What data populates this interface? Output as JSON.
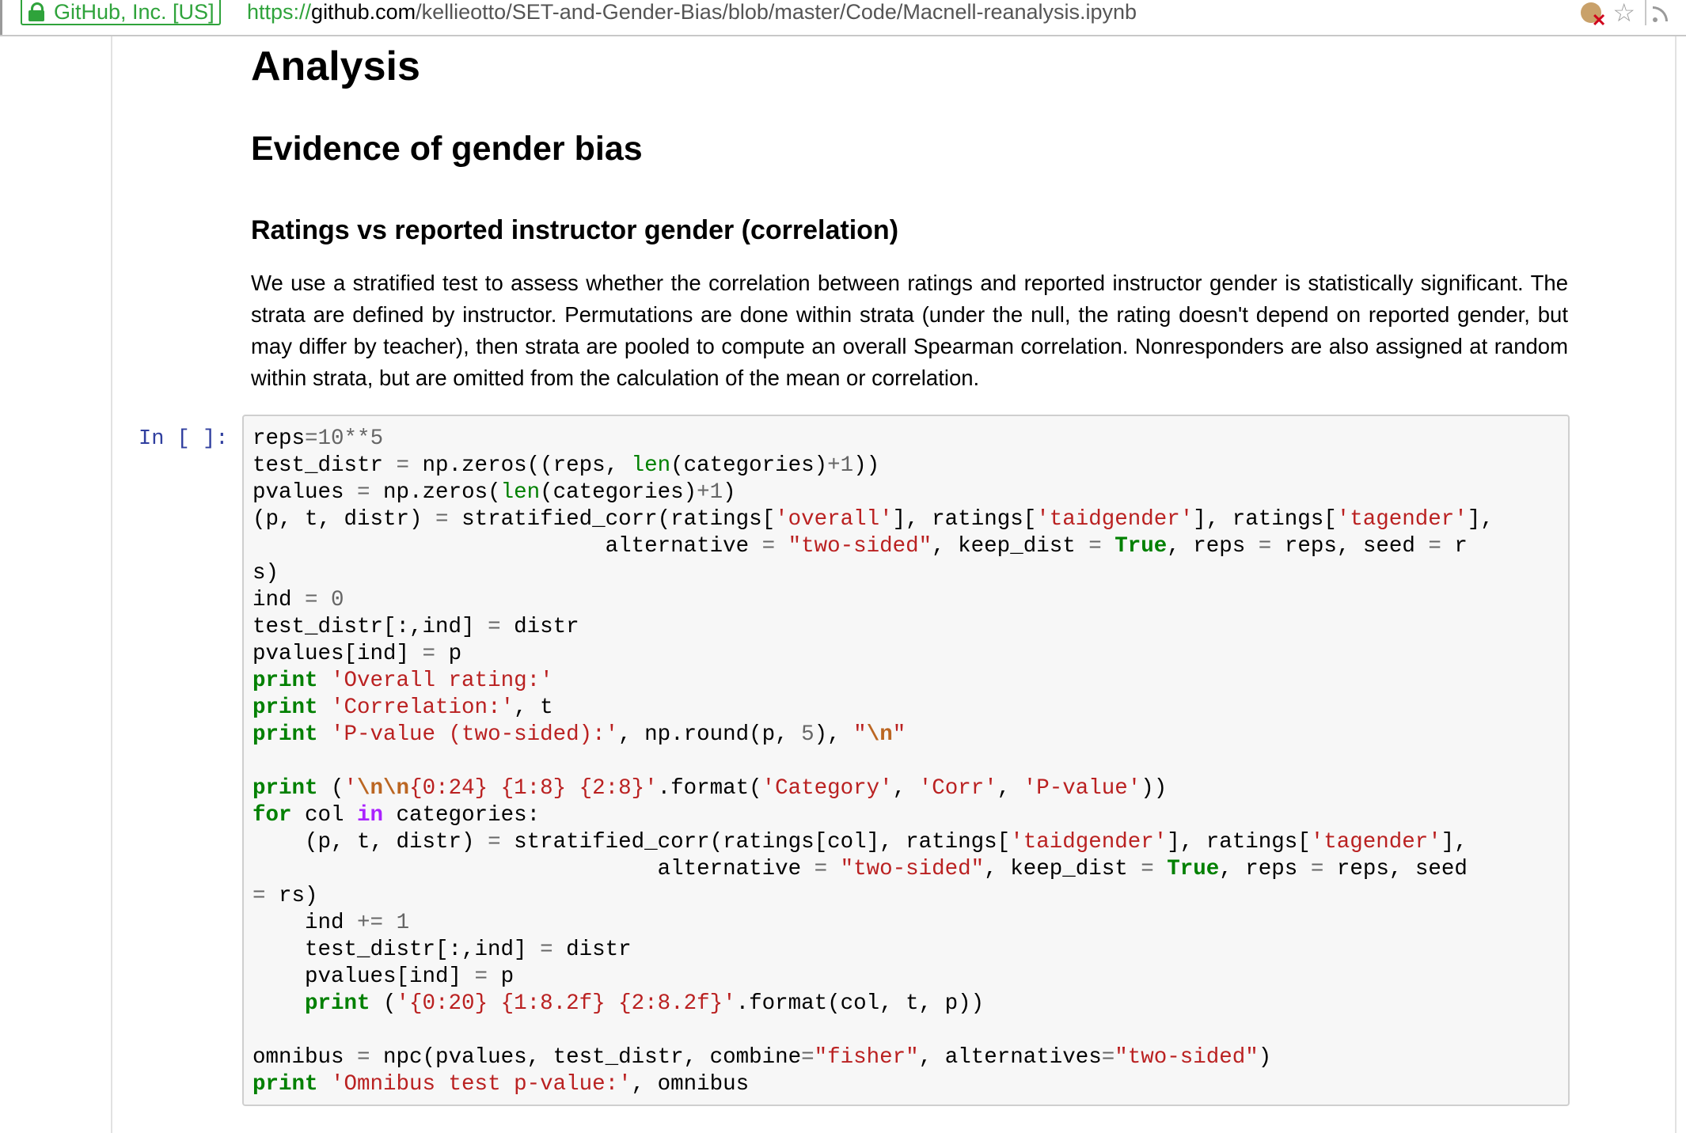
{
  "browser": {
    "site_identity": "GitHub, Inc. [US]",
    "url_scheme": "https://",
    "url_host": "github.com",
    "url_path": "/kellieotto/SET-and-Gender-Bias/blob/master/Code/Macnell-reanalysis.ipynb"
  },
  "notebook": {
    "h1": "Analysis",
    "h2": "Evidence of gender bias",
    "h3": "Ratings vs reported instructor gender (correlation)",
    "paragraph": "We use a stratified test to assess whether the correlation between ratings and reported instructor gender is statistically significant. The strata are defined by instructor. Permutations are done within strata (under the null, the rating doesn't depend on reported gender, but may differ by teacher), then strata are pooled to compute an overall Spearman correlation. Nonresponders are also assigned at random within strata, but are omitted from the calculation of the mean or correlation.",
    "cell_prompt": "In [ ]:",
    "code_lines": [
      [
        [
          "",
          "reps"
        ],
        [
          "op",
          "="
        ],
        [
          "num",
          "10"
        ],
        [
          "op",
          "**"
        ],
        [
          "num",
          "5"
        ]
      ],
      [
        [
          "",
          "test_distr "
        ],
        [
          "op",
          "="
        ],
        [
          "",
          " np.zeros((reps, "
        ],
        [
          "bi",
          "len"
        ],
        [
          "",
          "(categories)"
        ],
        [
          "op",
          "+"
        ],
        [
          "num",
          "1"
        ],
        [
          "",
          "))"
        ]
      ],
      [
        [
          "",
          "pvalues "
        ],
        [
          "op",
          "="
        ],
        [
          "",
          " np.zeros("
        ],
        [
          "bi",
          "len"
        ],
        [
          "",
          "(categories)"
        ],
        [
          "op",
          "+"
        ],
        [
          "num",
          "1"
        ],
        [
          "",
          ")"
        ]
      ],
      [
        [
          "",
          "(p, t, distr) "
        ],
        [
          "op",
          "="
        ],
        [
          "",
          " stratified_corr(ratings["
        ],
        [
          "str",
          "'overall'"
        ],
        [
          "",
          "], ratings["
        ],
        [
          "str",
          "'taidgender'"
        ],
        [
          "",
          "], ratings["
        ],
        [
          "str",
          "'tagender'"
        ],
        [
          "",
          "],"
        ]
      ],
      [
        [
          "",
          "                           alternative "
        ],
        [
          "op",
          "="
        ],
        [
          "",
          " "
        ],
        [
          "str",
          "\"two-sided\""
        ],
        [
          "",
          ", keep_dist "
        ],
        [
          "op",
          "="
        ],
        [
          "",
          " "
        ],
        [
          "kt",
          "True"
        ],
        [
          "",
          ", reps "
        ],
        [
          "op",
          "="
        ],
        [
          "",
          " reps, seed "
        ],
        [
          "op",
          "="
        ],
        [
          "",
          " r"
        ]
      ],
      [
        [
          "",
          "s)"
        ]
      ],
      [
        [
          "",
          "ind "
        ],
        [
          "op",
          "="
        ],
        [
          "",
          " "
        ],
        [
          "num",
          "0"
        ]
      ],
      [
        [
          "",
          "test_distr[:,ind] "
        ],
        [
          "op",
          "="
        ],
        [
          "",
          " distr"
        ]
      ],
      [
        [
          "",
          "pvalues[ind] "
        ],
        [
          "op",
          "="
        ],
        [
          "",
          " p"
        ]
      ],
      [
        [
          "kw",
          "print"
        ],
        [
          "",
          " "
        ],
        [
          "str",
          "'Overall rating:'"
        ]
      ],
      [
        [
          "kw",
          "print"
        ],
        [
          "",
          " "
        ],
        [
          "str",
          "'Correlation:'"
        ],
        [
          "",
          ", t"
        ]
      ],
      [
        [
          "kw",
          "print"
        ],
        [
          "",
          " "
        ],
        [
          "str",
          "'P-value (two-sided):'"
        ],
        [
          "",
          ", np.round(p, "
        ],
        [
          "num",
          "5"
        ],
        [
          "",
          "), "
        ],
        [
          "str",
          "\""
        ],
        [
          "esc",
          "\\n"
        ],
        [
          "str",
          "\""
        ]
      ],
      [
        [
          "",
          ""
        ]
      ],
      [
        [
          "kw",
          "print"
        ],
        [
          "",
          " ("
        ],
        [
          "str",
          "'"
        ],
        [
          "esc",
          "\\n\\n"
        ],
        [
          "str",
          "{0:24} {1:8} {2:8}'"
        ],
        [
          "",
          ".format("
        ],
        [
          "str",
          "'Category'"
        ],
        [
          "",
          ", "
        ],
        [
          "str",
          "'Corr'"
        ],
        [
          "",
          ", "
        ],
        [
          "str",
          "'P-value'"
        ],
        [
          "",
          "))"
        ]
      ],
      [
        [
          "kw",
          "for"
        ],
        [
          "",
          " col "
        ],
        [
          "kwin",
          "in"
        ],
        [
          "",
          " categories:"
        ]
      ],
      [
        [
          "",
          "    (p, t, distr) "
        ],
        [
          "op",
          "="
        ],
        [
          "",
          " stratified_corr(ratings[col], ratings["
        ],
        [
          "str",
          "'taidgender'"
        ],
        [
          "",
          "], ratings["
        ],
        [
          "str",
          "'tagender'"
        ],
        [
          "",
          "],"
        ]
      ],
      [
        [
          "",
          "                               alternative "
        ],
        [
          "op",
          "="
        ],
        [
          "",
          " "
        ],
        [
          "str",
          "\"two-sided\""
        ],
        [
          "",
          ", keep_dist "
        ],
        [
          "op",
          "="
        ],
        [
          "",
          " "
        ],
        [
          "kt",
          "True"
        ],
        [
          "",
          ", reps "
        ],
        [
          "op",
          "="
        ],
        [
          "",
          " reps, seed"
        ]
      ],
      [
        [
          "op",
          "="
        ],
        [
          "",
          " rs)"
        ]
      ],
      [
        [
          "",
          "    ind "
        ],
        [
          "op",
          "+="
        ],
        [
          "",
          " "
        ],
        [
          "num",
          "1"
        ]
      ],
      [
        [
          "",
          "    test_distr[:,ind] "
        ],
        [
          "op",
          "="
        ],
        [
          "",
          " distr"
        ]
      ],
      [
        [
          "",
          "    pvalues[ind] "
        ],
        [
          "op",
          "="
        ],
        [
          "",
          " p"
        ]
      ],
      [
        [
          "",
          "    "
        ],
        [
          "kw",
          "print"
        ],
        [
          "",
          " ("
        ],
        [
          "str",
          "'{0:20} {1:8.2f} {2:8.2f}'"
        ],
        [
          "",
          ".format(col, t, p))"
        ]
      ],
      [
        [
          "",
          ""
        ]
      ],
      [
        [
          "",
          "omnibus "
        ],
        [
          "op",
          "="
        ],
        [
          "",
          " npc(pvalues, test_distr, combine"
        ],
        [
          "op",
          "="
        ],
        [
          "str",
          "\"fisher\""
        ],
        [
          "",
          ", alternatives"
        ],
        [
          "op",
          "="
        ],
        [
          "str",
          "\"two-sided\""
        ],
        [
          "",
          ")"
        ]
      ],
      [
        [
          "kw",
          "print"
        ],
        [
          "",
          " "
        ],
        [
          "str",
          "'Omnibus test p-value:'"
        ],
        [
          "",
          ", omnibus"
        ]
      ]
    ]
  }
}
